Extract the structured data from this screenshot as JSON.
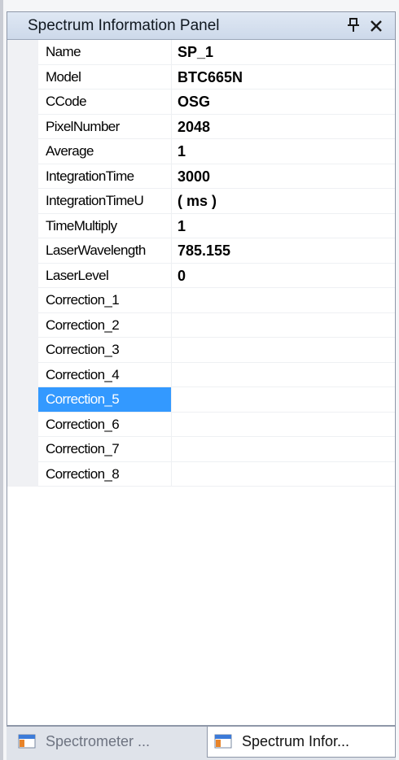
{
  "panel": {
    "title": "Spectrum Information Panel",
    "pin_icon": "pin-icon",
    "close_icon": "close-icon"
  },
  "properties": [
    {
      "name": "Name",
      "value": "SP_1"
    },
    {
      "name": "Model",
      "value": "BTC665N"
    },
    {
      "name": "CCode",
      "value": "OSG"
    },
    {
      "name": "PixelNumber",
      "value": "2048"
    },
    {
      "name": "Average",
      "value": "1"
    },
    {
      "name": "IntegrationTime",
      "value": "3000"
    },
    {
      "name": "IntegrationTimeU",
      "value": "( ms )"
    },
    {
      "name": "TimeMultiply",
      "value": "1"
    },
    {
      "name": "LaserWavelength",
      "value": "785.155"
    },
    {
      "name": "LaserLevel",
      "value": "0"
    },
    {
      "name": "Correction_1",
      "value": ""
    },
    {
      "name": "Correction_2",
      "value": ""
    },
    {
      "name": "Correction_3",
      "value": ""
    },
    {
      "name": "Correction_4",
      "value": ""
    },
    {
      "name": "Correction_5",
      "value": ""
    },
    {
      "name": "Correction_6",
      "value": ""
    },
    {
      "name": "Correction_7",
      "value": ""
    },
    {
      "name": "Correction_8",
      "value": ""
    }
  ],
  "selected_property": "Correction_5",
  "tabs": [
    {
      "label": "Spectrometer ...",
      "active": false,
      "icon": "window-icon"
    },
    {
      "label": "Spectrum Infor...",
      "active": true,
      "icon": "window-icon"
    }
  ],
  "colors": {
    "selection": "#3399ff",
    "titlebar": "#cdd9ea",
    "border": "#8e97a8"
  }
}
